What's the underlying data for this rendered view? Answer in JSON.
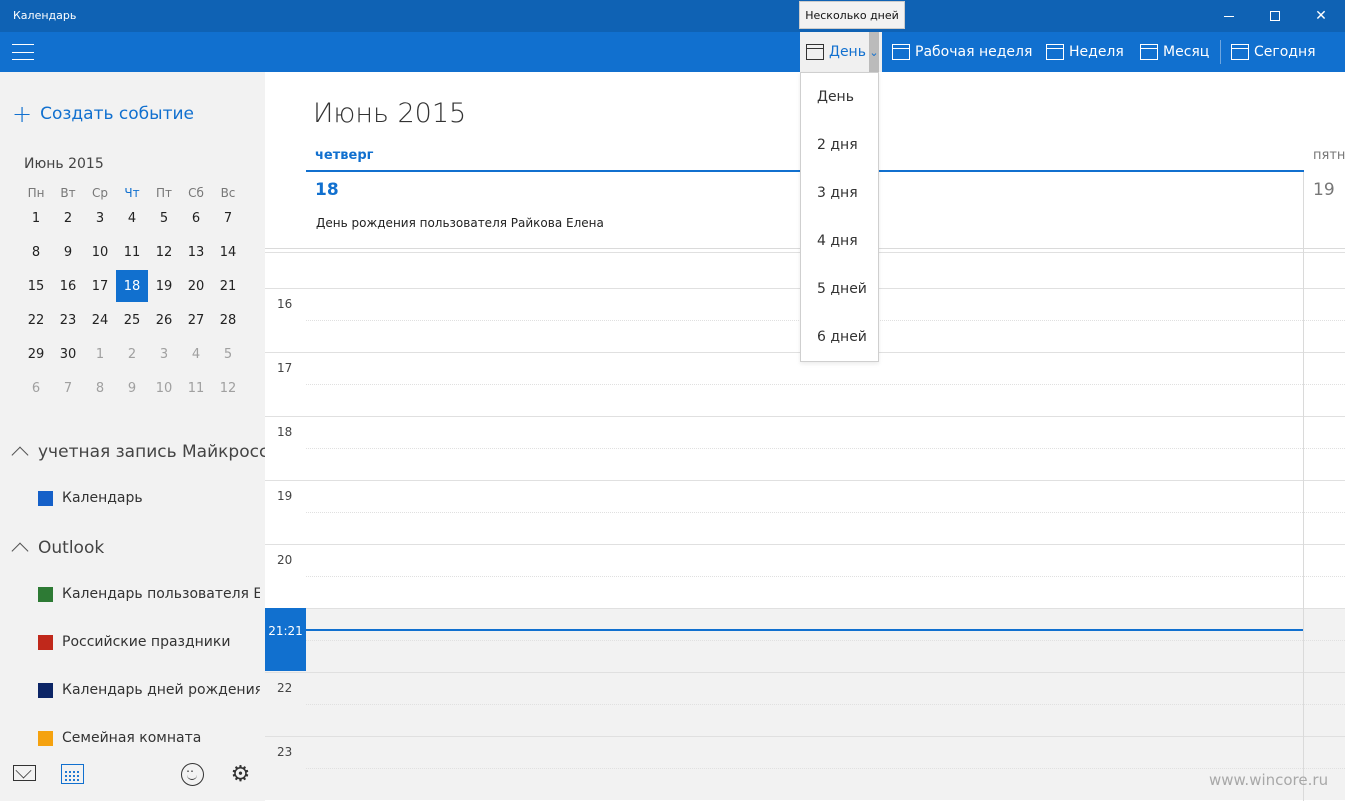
{
  "window": {
    "title": "Календарь",
    "tooltip": "Несколько дней"
  },
  "toolbar": {
    "day": "День",
    "work_week": "Рабочая неделя",
    "week": "Неделя",
    "month": "Месяц",
    "today": "Сегодня"
  },
  "view_dropdown": [
    "День",
    "2 дня",
    "3 дня",
    "4 дня",
    "5 дней",
    "6 дней"
  ],
  "sidebar": {
    "new_event": "Создать событие",
    "mini_calendar": {
      "title": "Июнь 2015",
      "weekdays": [
        "Пн",
        "Вт",
        "Ср",
        "Чт",
        "Пт",
        "Сб",
        "Вс"
      ],
      "weeks": [
        [
          "1",
          "2",
          "3",
          "4",
          "5",
          "6",
          "7"
        ],
        [
          "8",
          "9",
          "10",
          "11",
          "12",
          "13",
          "14"
        ],
        [
          "15",
          "16",
          "17",
          "18",
          "19",
          "20",
          "21"
        ],
        [
          "22",
          "23",
          "24",
          "25",
          "26",
          "27",
          "28"
        ],
        [
          "29",
          "30",
          "1",
          "2",
          "3",
          "4",
          "5"
        ],
        [
          "6",
          "7",
          "8",
          "9",
          "10",
          "11",
          "12"
        ]
      ],
      "selected": "18"
    },
    "accounts": [
      {
        "name": "учетная запись Майкросс",
        "calendars": [
          {
            "name": "Календарь",
            "color": "#1560c8"
          }
        ]
      },
      {
        "name": "Outlook",
        "calendars": [
          {
            "name": "Календарь пользователя Е",
            "color": "#2d7a34"
          },
          {
            "name": "Российские праздники",
            "color": "#c0281b"
          },
          {
            "name": "Календарь дней рождения",
            "color": "#0c2566"
          },
          {
            "name": "Семейная комната",
            "color": "#f5a20f"
          }
        ]
      }
    ]
  },
  "main": {
    "month_title": "Июнь 2015",
    "day_name": "четверг",
    "day_number": "18",
    "next_day_name": "пятн",
    "next_day_number": "19",
    "allday_event": "День рождения пользователя Райкова Елена",
    "hours": [
      "",
      "16",
      "17",
      "18",
      "19",
      "20",
      "21",
      "22",
      "23"
    ],
    "current_time": "21:21",
    "watermark": "www.wincore.ru"
  },
  "colors": {
    "accent": "#1170cf",
    "titlebar": "#0f62b4"
  }
}
